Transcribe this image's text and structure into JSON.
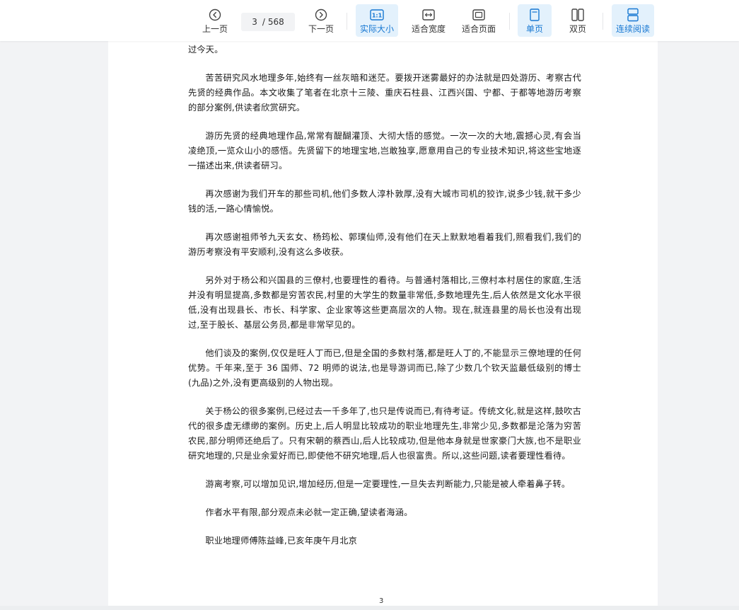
{
  "toolbar": {
    "prev_label": "上一页",
    "next_label": "下一页",
    "current_page": "3",
    "page_separator": "/",
    "total_pages": "568",
    "actual_size_label": "实际大小",
    "fit_width_label": "适合宽度",
    "fit_page_label": "适合页面",
    "single_page_label": "单页",
    "double_page_label": "双页",
    "continuous_label": "连续阅读",
    "actual_size_icon_text": "1:1",
    "accent_color": "#1677d2",
    "active_bg_color": "#e3f1fc"
  },
  "document": {
    "page_number": "3",
    "paragraphs": [
      "过今天。",
      "苦苦研究风水地理多年,始终有一丝灰暗和迷茫。要拨开迷雾最好的办法就是四处游历、考察古代先贤的经典作品。本文收集了笔者在北京十三陵、重庆石柱县、江西兴国、宁都、于都等地游历考察的部分案例,供读者欣赏研究。",
      "游历先贤的经典地理作品,常常有醍醐灌顶、大彻大悟的感觉。一次一次的大地,震撼心灵,有会当凌绝顶,一览众山小的感悟。先贤留下的地理宝地,岂敢独享,愿意用自己的专业技术知识,将这些宝地逐一描述出来,供读者研习。",
      "再次感谢为我们开车的那些司机,他们多数人淳朴敦厚,没有大城市司机的狡诈,说多少钱,就干多少钱的活,一路心情愉悦。",
      "再次感谢祖师爷九天玄女、杨筠松、郭璞仙师,没有他们在天上默默地看着我们,照看我们,我们的游历考察没有平安顺利,没有这么多收获。",
      "另外对于杨公和兴国县的三僚村,也要理性的看待。与普通村落相比,三僚村本村居住的家庭,生活并没有明显提高,多数都是穷苦农民,村里的大学生的数量非常低,多数地理先生,后人依然是文化水平很低,没有出现县长、市长、科学家、企业家等这些更高层次的人物。现在,就连县里的局长也没有出现过,至于股长、基层公务员,都是非常罕见的。",
      "他们谈及的案例,仅仅是旺人丁而已,但是全国的多数村落,都是旺人丁的,不能显示三僚地理的任何优势。千年来,至于 36 国师、72 明师的说法,也是导游词而已,除了少数几个钦天监最低级别的博士(九品)之外,没有更高级别的人物出现。",
      "关于杨公的很多案例,已经过去一千多年了,也只是传说而已,有待考证。传统文化,就是这样,鼓吹古代的很多虚无缥缈的案例。历史上,后人明显比较成功的职业地理先生,非常少见,多数都是沦落为穷苦农民,部分明师还绝后了。只有宋朝的蔡西山,后人比较成功,但是他本身就是世家豪门大族,也不是职业研究地理的,只是业余爱好而已,即使他不研究地理,后人也很富贵。所以,这些问题,读者要理性看待。",
      "游离考察,可以增加见识,增加经历,但是一定要理性,一旦失去判断能力,只能是被人牵着鼻子转。",
      "作者水平有限,部分观点未必就一定正确,望读者海涵。",
      "职业地理师傅陈益峰,已亥年庚午月北京"
    ]
  }
}
